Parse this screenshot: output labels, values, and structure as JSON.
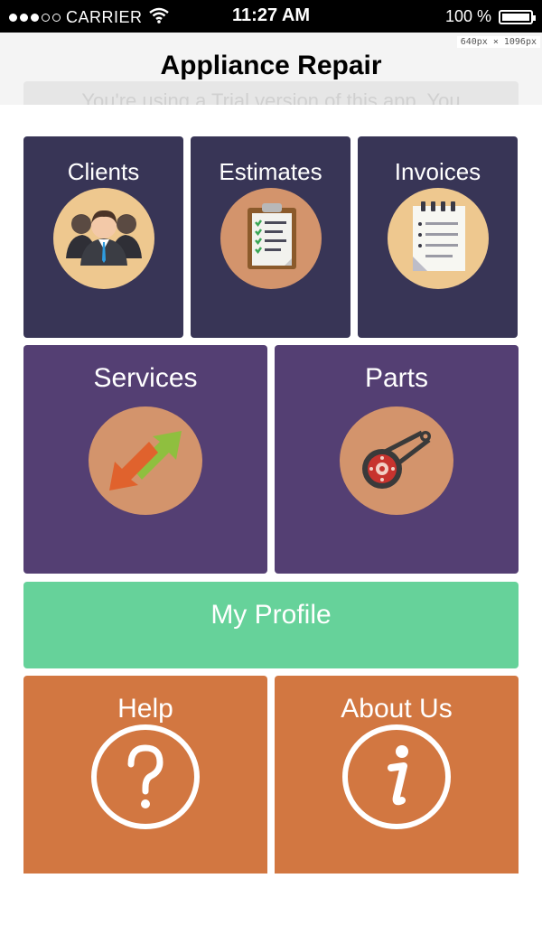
{
  "status_bar": {
    "carrier": "CARRIER",
    "time": "11:27 AM",
    "battery": "100 %",
    "signal_icon": "signal-dots-icon",
    "wifi_icon": "wifi-icon",
    "battery_icon": "battery-icon"
  },
  "header": {
    "title": "Appliance Repair",
    "size_note": "640px × 1096px",
    "trial_notice": "You're using a Trial version of this app. You"
  },
  "tiles": {
    "clients": {
      "label": "Clients",
      "icon": "people-icon"
    },
    "estimates": {
      "label": "Estimates",
      "icon": "clipboard-checklist-icon"
    },
    "invoices": {
      "label": "Invoices",
      "icon": "notepad-icon"
    },
    "services": {
      "label": "Services",
      "icon": "exchange-arrows-icon"
    },
    "parts": {
      "label": "Parts",
      "icon": "belt-pulley-icon"
    },
    "profile": {
      "label": "My Profile"
    },
    "help": {
      "label": "Help",
      "icon": "question-icon"
    },
    "about": {
      "label": "About Us",
      "icon": "info-icon"
    }
  },
  "colors": {
    "navy": "#383556",
    "purple": "#543f73",
    "green": "#66d29a",
    "orange": "#d27741",
    "icon_circle_light": "#eec88f",
    "icon_circle_dark": "#d3946c"
  }
}
